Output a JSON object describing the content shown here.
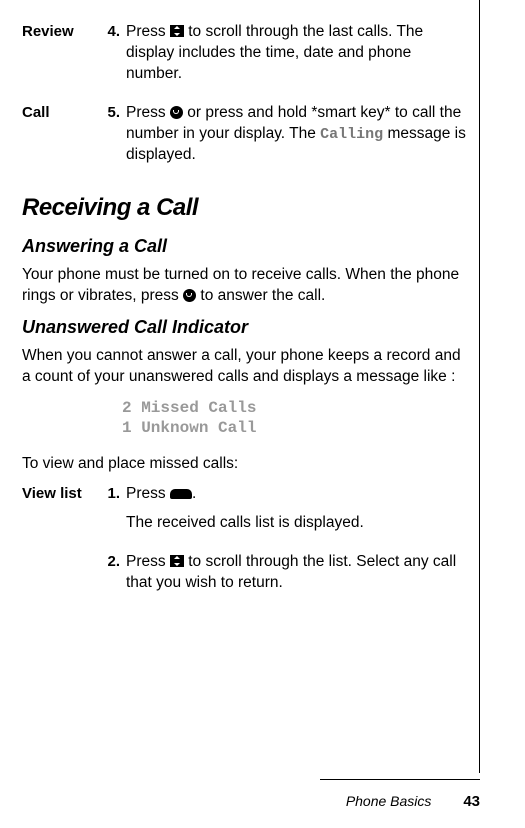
{
  "steps_top": [
    {
      "label": "Review",
      "num": "4.",
      "body_pre": "Press ",
      "icon": "scroll",
      "body_post": " to scroll through the last calls. The display includes the time, date and phone number."
    },
    {
      "label": "Call",
      "num": "5.",
      "body_pre": "Press ",
      "icon": "call",
      "body_mid": " or press and hold *smart key* to call the number in your display. The ",
      "mono": "Calling",
      "body_post": " message is displayed."
    }
  ],
  "section_title": "Receiving a Call",
  "sub1_title": "Answering a Call",
  "sub1_body_pre": "Your phone must be turned on to receive calls. When the phone rings or vibrates, press ",
  "sub1_body_post": " to answer the call.",
  "sub2_title": "Unanswered Call Indicator",
  "sub2_body": "When you cannot answer a call, your phone keeps a record and a count of your unanswered calls and displays a message like :",
  "missed_line1": "2 Missed Calls",
  "missed_line2": "1 Unknown Call",
  "view_intro": "To view and place missed calls:",
  "steps_bottom": [
    {
      "label": "View list",
      "num": "1.",
      "body_pre": "Press ",
      "icon": "menu",
      "body_post": ".",
      "sub": "The received calls list is displayed."
    },
    {
      "label": "",
      "num": "2.",
      "body_pre": "Press ",
      "icon": "scroll",
      "body_post": " to scroll through the list. Select any call that you wish to return."
    }
  ],
  "footer_section": "Phone Basics",
  "footer_page": "43"
}
